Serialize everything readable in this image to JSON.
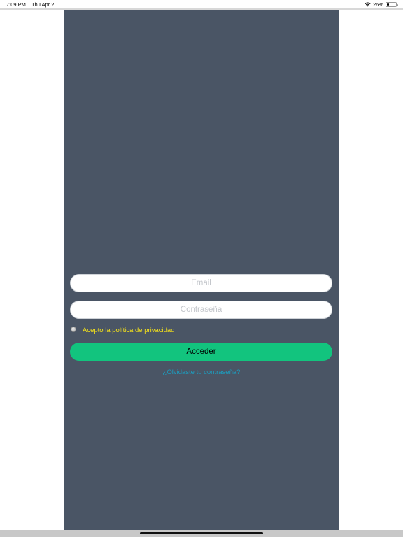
{
  "status_bar": {
    "time": "7:09 PM",
    "date": "Thu Apr 2",
    "battery_text": "26%",
    "battery_level": 0.26,
    "icons": [
      "wifi-icon",
      "battery-icon"
    ]
  },
  "colors": {
    "panel_background": "#4a5565",
    "primary_button": "#12c47e",
    "privacy_text": "#f4e11a",
    "link_text": "#1b9fc1"
  },
  "form": {
    "email": {
      "value": "",
      "placeholder": "Email"
    },
    "password": {
      "value": "",
      "placeholder": "Contraseña"
    },
    "privacy_label": "Acepto la política de privacidad",
    "submit_label": "Acceder",
    "forgot_password": "¿Olvidaste tu contraseña?"
  }
}
